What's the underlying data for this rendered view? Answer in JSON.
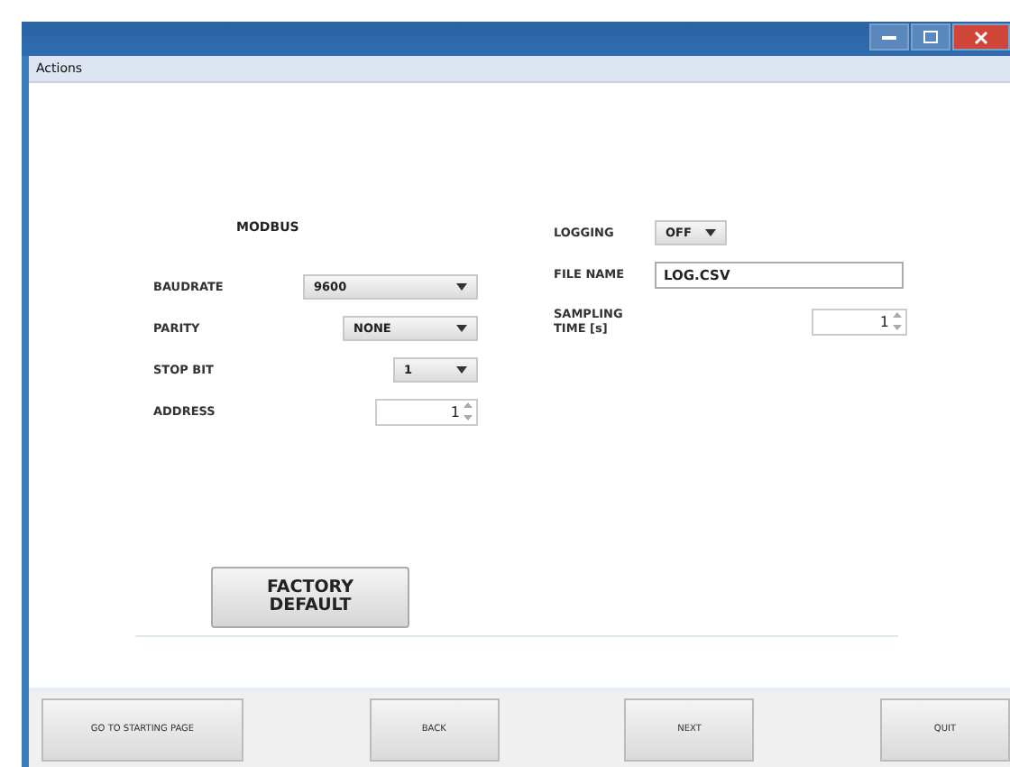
{
  "menu_bar": {
    "items": [
      "Actions"
    ]
  },
  "modbus": {
    "title": "MODBUS",
    "fields": [
      {
        "label": "BAUDRATE",
        "kind": "dropdown",
        "value": "9600"
      },
      {
        "label": "PARITY",
        "kind": "dropdown",
        "value": "NONE"
      },
      {
        "label": "STOP BIT",
        "kind": "dropdown",
        "value": "1"
      },
      {
        "label": "ADDRESS",
        "kind": "spinner",
        "value": "1"
      }
    ]
  },
  "logging": {
    "fields": [
      {
        "label": "LOGGING",
        "kind": "dropdown",
        "value": "OFF"
      },
      {
        "label": "FILE NAME",
        "kind": "text",
        "value": "LOG.CSV"
      },
      {
        "label": "SAMPLING TIME [s]",
        "kind": "spinner",
        "value": "1"
      }
    ]
  },
  "factory_button": "FACTORY DEFAULT",
  "nav_buttons": [
    "GO TO STARTING PAGE",
    "BACK",
    "NEXT",
    "QUIT"
  ]
}
